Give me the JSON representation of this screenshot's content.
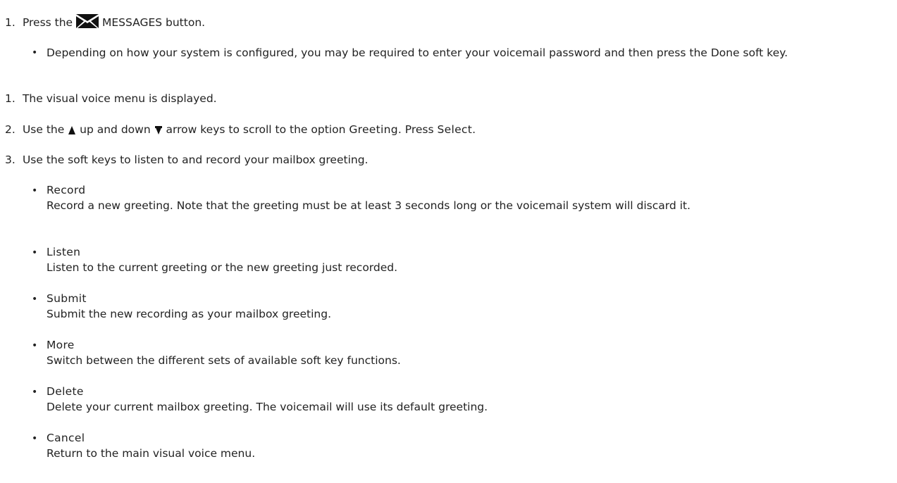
{
  "step1": {
    "number": "1.",
    "before_icon": "Press the",
    "icon": "envelope-icon",
    "after_icon": "MESSAGES button."
  },
  "step1_note": "Depending on how your system is configured, you may be required to enter your voicemail password and then press the Done soft key.",
  "steps": [
    {
      "number": "1.",
      "text": "The visual voice menu is displayed."
    },
    {
      "number": "2.",
      "part1": "Use the",
      "up_icon": "up-arrow-icon",
      "part2": "up and down",
      "down_icon": "down-arrow-icon",
      "part3": "arrow keys to scroll to the option",
      "option": "Greeting",
      "part4": ". Press",
      "select_key": "Select",
      "part5": "."
    },
    {
      "number": "3.",
      "text": "Use the soft keys to listen to and record your mailbox greeting."
    }
  ],
  "soft_keys": [
    {
      "term": "Record",
      "description": "Record a new greeting. Note that the greeting must be at least 3 seconds long or the voicemail system will discard it."
    },
    {
      "term": "Listen",
      "description": "Listen to the current greeting or the new greeting just recorded."
    },
    {
      "term": "Submit",
      "description": "Submit the new recording as your mailbox greeting."
    },
    {
      "term": "More",
      "description": "Switch between the different sets of available soft key functions."
    },
    {
      "term": "Delete",
      "description": "Delete your current mailbox greeting. The voicemail will use its default greeting."
    },
    {
      "term": "Cancel",
      "description": "Return to the main visual voice menu."
    }
  ],
  "bullet_char": "•"
}
